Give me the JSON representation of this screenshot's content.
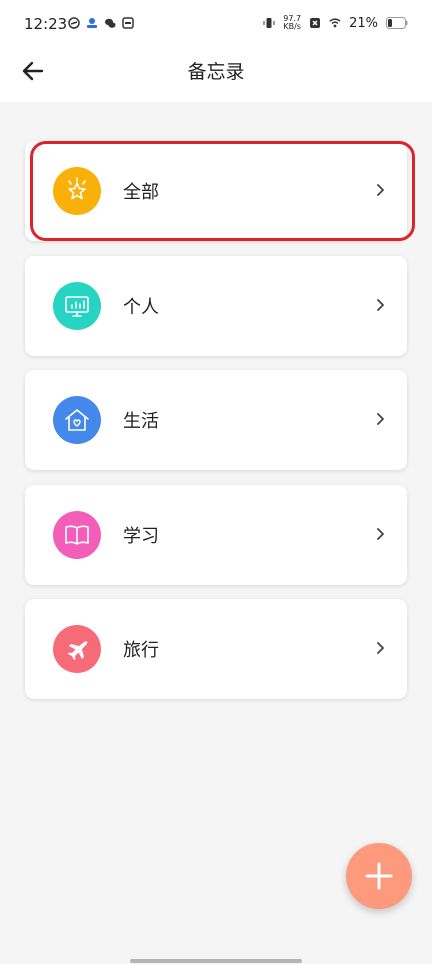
{
  "status_bar": {
    "time": "12:23",
    "net_speed_value": "97.7",
    "net_speed_unit": "KB/s",
    "battery": "21%"
  },
  "header": {
    "title": "备忘录",
    "back_icon": "arrow-left-icon"
  },
  "categories": [
    {
      "label": "全部",
      "icon": "star-icon",
      "color": "#f9b10a"
    },
    {
      "label": "个人",
      "icon": "monitor-chart-icon",
      "color": "#27d3c2"
    },
    {
      "label": "生活",
      "icon": "home-heart-icon",
      "color": "#4488ec"
    },
    {
      "label": "学习",
      "icon": "book-icon",
      "color": "#f35fb8"
    },
    {
      "label": "旅行",
      "icon": "airplane-icon",
      "color": "#f76a78"
    }
  ],
  "fab": {
    "icon": "plus-icon",
    "color": "#fd9a7e"
  },
  "highlight_color": "#e0202a"
}
